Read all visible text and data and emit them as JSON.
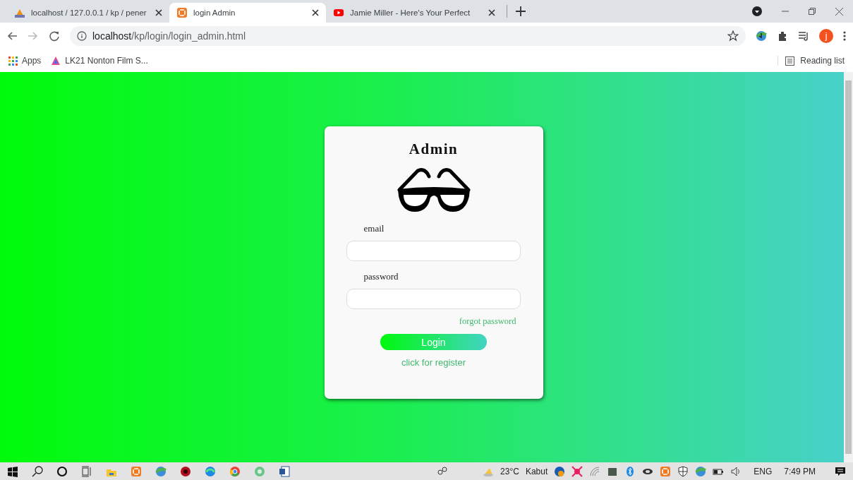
{
  "browser": {
    "tabs": [
      {
        "title": "localhost / 127.0.0.1 / kp / pener",
        "selected": false
      },
      {
        "title": "login Admin",
        "selected": true
      },
      {
        "title": "Jamie Miller - Here's Your Perfect",
        "selected": false
      }
    ],
    "address": {
      "host": "localhost",
      "path": "/kp/login/login_admin.html"
    },
    "profile_initial": "j",
    "bookmarks": [
      {
        "label": "Apps"
      },
      {
        "label": "LK21 Nonton Film S..."
      }
    ],
    "reading_list": "Reading list"
  },
  "login": {
    "title": "Admin",
    "fields": [
      {
        "label": "email"
      },
      {
        "label": "password"
      }
    ],
    "forgot": "forgot password",
    "button": "Login",
    "register": "click for register"
  },
  "taskbar": {
    "weather": {
      "temp": "23°C",
      "condition": "Kabut"
    },
    "language": "ENG",
    "time": "7:49 PM"
  }
}
